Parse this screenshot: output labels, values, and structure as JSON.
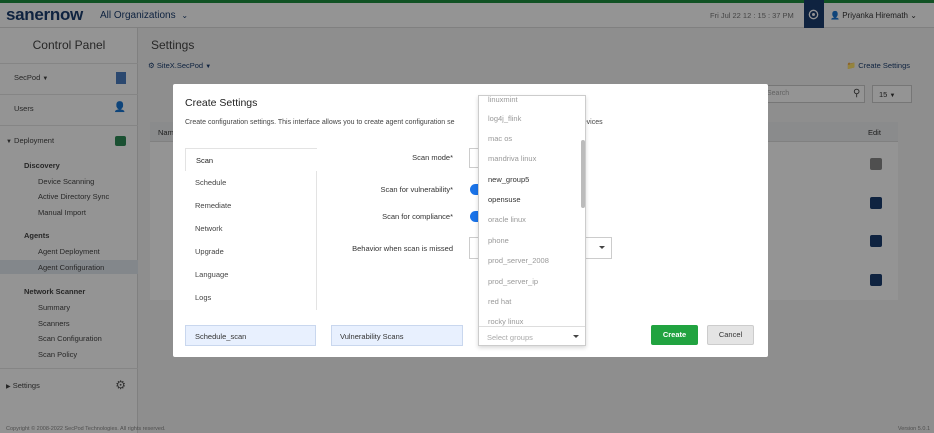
{
  "topbar": {
    "logo": "sanernow",
    "org": "All Organizations",
    "datetime": "Fri Jul 22   12 : 15 : 37 PM",
    "user": "Priyanka Hiremath"
  },
  "sidebar": {
    "title": "Control Panel",
    "secpod": "SecPod",
    "users": "Users",
    "deployment": "Deployment",
    "discovery": "Discovery",
    "device_scanning": "Device Scanning",
    "ad_sync": "Active Directory Sync",
    "manual_import": "Manual Import",
    "agents": "Agents",
    "agent_deployment": "Agent Deployment",
    "agent_configuration": "Agent Configuration",
    "network_scanner": "Network Scanner",
    "summary": "Summary",
    "scanners": "Scanners",
    "scan_configuration": "Scan Configuration",
    "scan_policy": "Scan Policy",
    "settings": "Settings"
  },
  "main": {
    "title": "Settings",
    "site": "SiteX.SecPod",
    "create_settings_link": "Create Settings",
    "search_placeholder": "Search",
    "page_size": "15",
    "col_name": "Nam",
    "col_edit": "Edit"
  },
  "modal": {
    "title": "Create Settings",
    "description": "Create configuration settings. This interface allows you to create agent configuration se",
    "description_tail": "f devices",
    "tabs": [
      "Scan",
      "Schedule",
      "Remediate",
      "Network",
      "Upgrade",
      "Language",
      "Logs"
    ],
    "scan_mode_label": "Scan mode*",
    "scan_vuln_label": "Scan for vulnerability*",
    "scan_compliance_label": "Scan for compliance*",
    "behavior_label": "Behavior when scan is missed",
    "schedule_name": "Schedule_scan",
    "scan_type": "Vulnerability Scans",
    "group_placeholder": "Select groups",
    "create_button": "Create",
    "cancel_button": "Cancel"
  },
  "dropdown": {
    "items": [
      "linuxmint",
      "log4j_flink",
      "mac os",
      "mandriva linux",
      "new_group5",
      "opensuse",
      "oracle linux",
      "phone",
      "prod_server_2008",
      "prod_server_ip",
      "red hat",
      "rocky linux"
    ]
  },
  "footer": {
    "copyright": "Copyright © 2008-2022 SecPod Technologies. All rights reserved.",
    "version": "Version 5.0.1"
  },
  "colors": {
    "brand": "#1a3d6e",
    "accent_green": "#21a340",
    "toggle_blue": "#1a73e8"
  }
}
